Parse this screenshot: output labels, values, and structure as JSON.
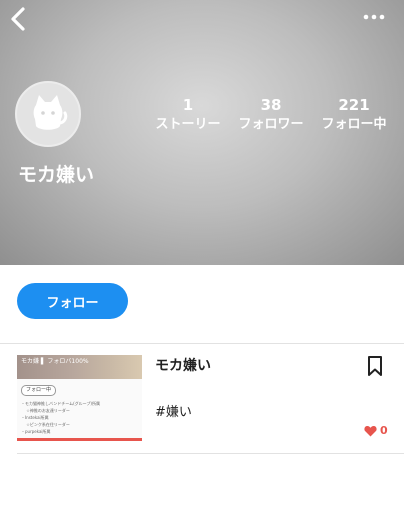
{
  "header": {
    "username": "モカ嫌い",
    "stats": [
      {
        "value": "1",
        "label": "ストーリー"
      },
      {
        "value": "38",
        "label": "フォロワー"
      },
      {
        "value": "221",
        "label": "フォロー中"
      }
    ],
    "icons": {
      "back": "back-chevron-icon",
      "more": "more-dots-icon",
      "avatar": "cat-avatar-icon"
    }
  },
  "actions": {
    "follow_label": "フォロー"
  },
  "story": {
    "title": "モカ嫌い",
    "hashtag": "#嫌い",
    "likes": "0",
    "thumbnail": {
      "top_text": "モカ嫌 ▌  フォロバ100%",
      "badge": "フォロー中",
      "lines": [
        "・モカ猫神推しバンドチーム(グループ)所属",
        "　 ☆神推のお友達リーダー",
        "・Instekai所属",
        "　 ☆ピンク系在住リーダー",
        "・purpekai所属"
      ]
    },
    "icons": {
      "bookmark": "bookmark-icon",
      "heart": "heart-icon"
    }
  },
  "colors": {
    "accent": "#1d8ff1",
    "like": "#e7554d"
  }
}
